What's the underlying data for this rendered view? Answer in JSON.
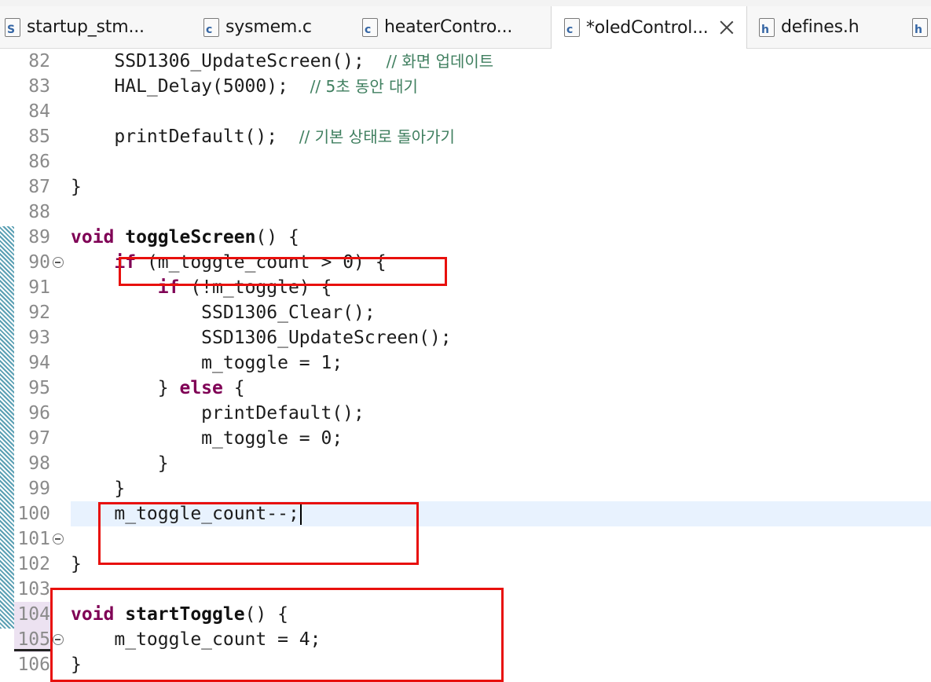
{
  "tabs": [
    {
      "label": "startup_stm...",
      "icon": "S",
      "icon_name": "asm-file-icon"
    },
    {
      "label": "sysmem.c",
      "icon": "c",
      "icon_name": "c-file-icon"
    },
    {
      "label": "heaterContro...",
      "icon": "c",
      "icon_name": "c-file-icon"
    },
    {
      "label": "*oledControl...",
      "icon": "c",
      "icon_name": "c-file-icon",
      "active": true
    },
    {
      "label": "defines.h",
      "icon": "h",
      "icon_name": "h-file-icon"
    },
    {
      "label": "",
      "icon": "h",
      "icon_name": "h-file-icon"
    }
  ],
  "lines": [
    {
      "n": "82",
      "code": [
        {
          "t": "    SSD1306_UpdateScreen();  "
        },
        {
          "t": "// 화면 업데이트",
          "c": "cm"
        }
      ]
    },
    {
      "n": "83",
      "code": [
        {
          "t": "    HAL_Delay(5000);  "
        },
        {
          "t": "// 5초 동안 대기",
          "c": "cm"
        }
      ]
    },
    {
      "n": "84",
      "code": []
    },
    {
      "n": "85",
      "code": [
        {
          "t": "    printDefault();  "
        },
        {
          "t": "// 기본 상태로 돌아가기",
          "c": "cm"
        }
      ]
    },
    {
      "n": "86",
      "code": []
    },
    {
      "n": "87",
      "code": [
        {
          "t": "}"
        }
      ]
    },
    {
      "n": "88",
      "code": []
    },
    {
      "n": "89",
      "code": [
        {
          "t": "void",
          "c": "kw"
        },
        {
          "t": " "
        },
        {
          "t": "toggleScreen",
          "c": "fn"
        },
        {
          "t": "() {"
        }
      ]
    },
    {
      "n": "90",
      "fold": true,
      "code": [
        {
          "t": "    "
        },
        {
          "t": "if",
          "c": "kw"
        },
        {
          "t": " (m_toggle_count > 0) {"
        }
      ]
    },
    {
      "n": "91",
      "code": [
        {
          "t": "        "
        },
        {
          "t": "if",
          "c": "kw"
        },
        {
          "t": " (!m_toggle) {"
        }
      ]
    },
    {
      "n": "92",
      "code": [
        {
          "t": "            SSD1306_Clear();"
        }
      ]
    },
    {
      "n": "93",
      "code": [
        {
          "t": "            SSD1306_UpdateScreen();"
        }
      ]
    },
    {
      "n": "94",
      "code": [
        {
          "t": "            m_toggle = 1;"
        }
      ]
    },
    {
      "n": "95",
      "code": [
        {
          "t": "        } "
        },
        {
          "t": "else",
          "c": "kw"
        },
        {
          "t": " {"
        }
      ]
    },
    {
      "n": "96",
      "code": [
        {
          "t": "            printDefault();"
        }
      ]
    },
    {
      "n": "97",
      "code": [
        {
          "t": "            m_toggle = 0;"
        }
      ]
    },
    {
      "n": "98",
      "code": [
        {
          "t": "        }"
        }
      ]
    },
    {
      "n": "99",
      "code": [
        {
          "t": "    }"
        }
      ]
    },
    {
      "n": "100",
      "current": true,
      "caret": true,
      "code": [
        {
          "t": "    m_toggle_count--;"
        }
      ]
    },
    {
      "n": "101",
      "fold": true,
      "code": []
    },
    {
      "n": "102",
      "code": [
        {
          "t": "}"
        }
      ]
    },
    {
      "n": "103",
      "code": []
    },
    {
      "n": "104",
      "pink": true,
      "code": [
        {
          "t": "void",
          "c": "kw"
        },
        {
          "t": " "
        },
        {
          "t": "startToggle",
          "c": "fn"
        },
        {
          "t": "() {"
        }
      ]
    },
    {
      "n": "105",
      "pink": true,
      "fold": true,
      "code": [
        {
          "t": "    m_toggle_count = 4;"
        }
      ]
    },
    {
      "n": "106",
      "code": [
        {
          "t": "}"
        }
      ]
    }
  ],
  "colors": {
    "keyword": "#7f0055",
    "comment": "#3f7f5f",
    "annotation": "#e8100d",
    "current_line": "#e8f2fe"
  }
}
